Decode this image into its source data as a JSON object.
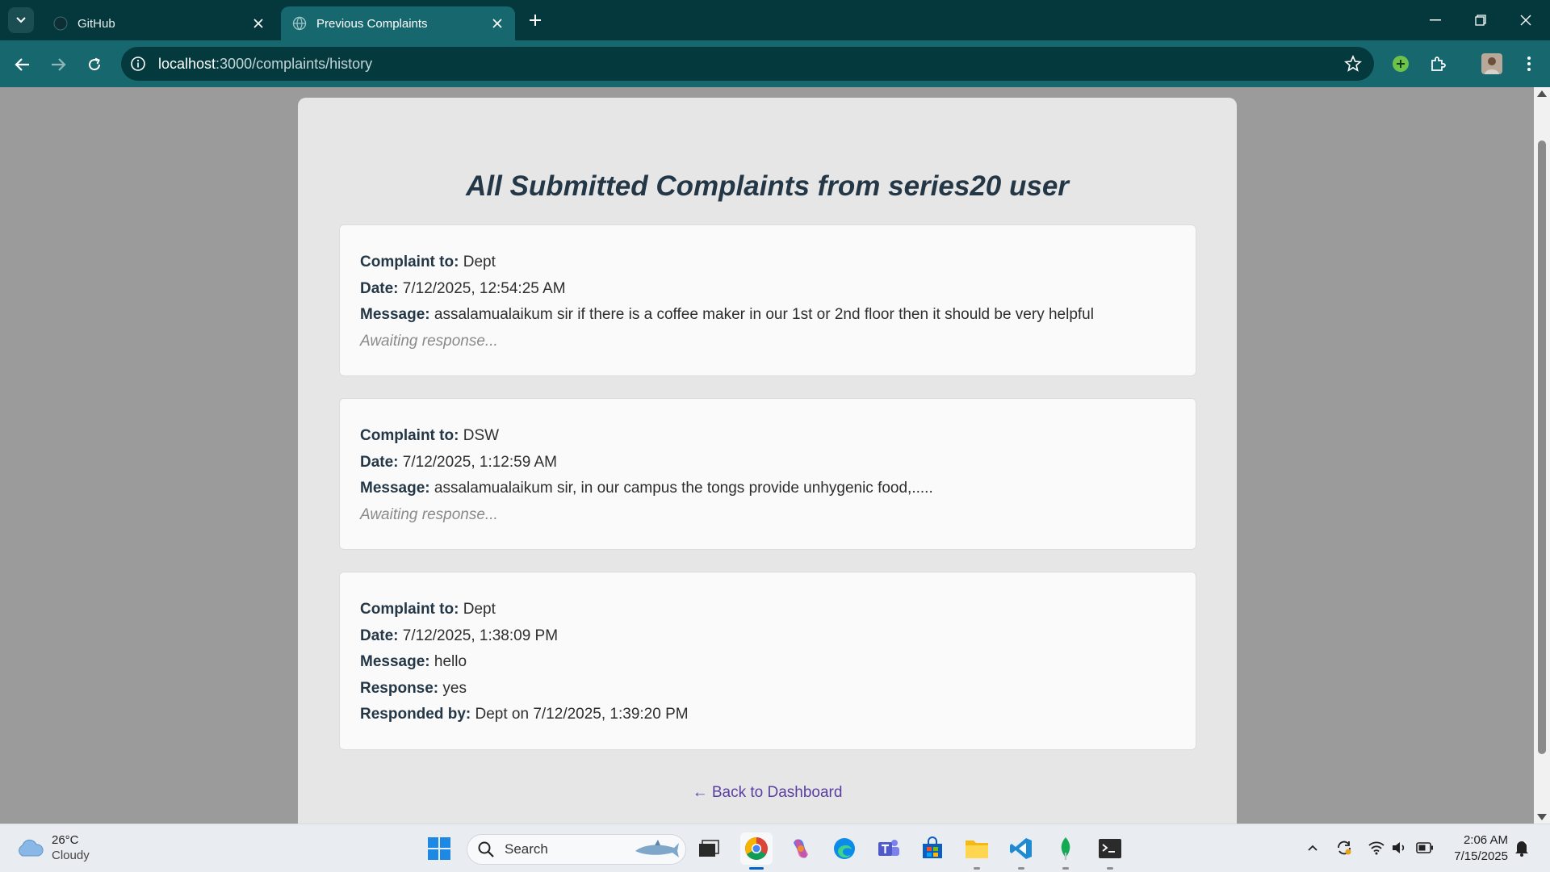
{
  "browser": {
    "tabs": [
      {
        "title": "GitHub",
        "favicon": "github-icon",
        "active": false
      },
      {
        "title": "Previous Complaints",
        "favicon": "globe-icon",
        "active": true
      }
    ],
    "url_host": "localhost",
    "url_rest": ":3000/complaints/history",
    "accent_color": "#05383d",
    "toolbar_color": "#17686e"
  },
  "page": {
    "heading": "All Submitted Complaints from series20 user",
    "labels": {
      "to": "Complaint to:",
      "date": "Date:",
      "message": "Message:",
      "response": "Response:",
      "responded_by": "Responded by:"
    },
    "complaints": [
      {
        "to": "Dept",
        "date": "7/12/2025, 12:54:25 AM",
        "message": "assalamualaikum sir if there is a coffee maker in our 1st or 2nd floor then it should be very helpful",
        "status": "Awaiting response..."
      },
      {
        "to": "DSW",
        "date": "7/12/2025, 1:12:59 AM",
        "message": "assalamualaikum sir, in our campus the tongs provide unhygenic food,.....",
        "status": "Awaiting response..."
      },
      {
        "to": "Dept",
        "date": "7/12/2025, 1:38:09 PM",
        "message": "hello",
        "response": "yes",
        "responded_by": "Dept on 7/12/2025, 1:39:20 PM"
      }
    ],
    "back_link": "← Back to Dashboard"
  },
  "taskbar": {
    "weather_temp": "26°C",
    "weather_cond": "Cloudy",
    "search_placeholder": "Search",
    "time": "2:06 AM",
    "date": "7/15/2025"
  }
}
